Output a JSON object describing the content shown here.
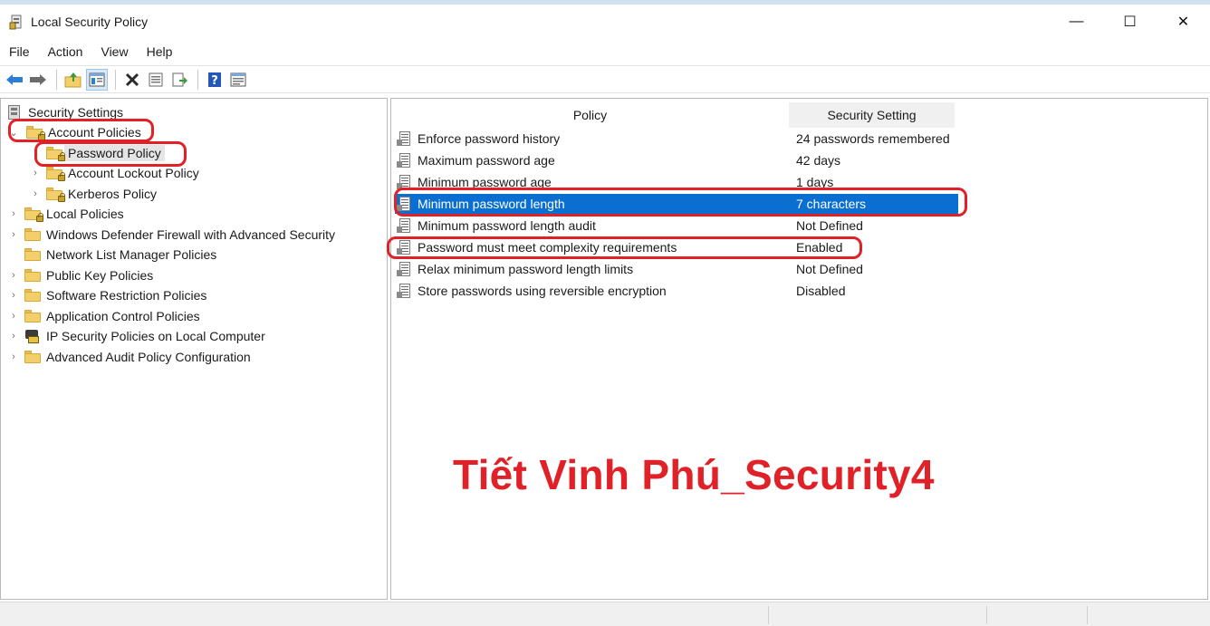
{
  "window": {
    "title": "Local Security Policy",
    "controls": {
      "minimize": "—",
      "maximize": "☐",
      "close": "✕"
    }
  },
  "menu": [
    "File",
    "Action",
    "View",
    "Help"
  ],
  "toolbar": {
    "buttons": [
      "back-icon",
      "forward-icon",
      "up-folder-icon",
      "show-hide-tree-icon",
      "delete-icon",
      "properties-icon",
      "export-list-icon",
      "help-icon",
      "view-icon"
    ]
  },
  "tree": {
    "root": "Security Settings",
    "items": [
      {
        "label": "Account Policies",
        "expanded": true
      },
      {
        "label": "Password Policy",
        "selected": true
      },
      {
        "label": "Account Lockout Policy"
      },
      {
        "label": "Kerberos Policy"
      },
      {
        "label": "Local Policies"
      },
      {
        "label": "Windows Defender Firewall with Advanced Security"
      },
      {
        "label": "Network List Manager Policies"
      },
      {
        "label": "Public Key Policies"
      },
      {
        "label": "Software Restriction Policies"
      },
      {
        "label": "Application Control Policies"
      },
      {
        "label": "IP Security Policies on Local Computer"
      },
      {
        "label": "Advanced Audit Policy Configuration"
      }
    ]
  },
  "list": {
    "columns": {
      "policy": "Policy",
      "setting": "Security Setting"
    },
    "rows": [
      {
        "policy": "Enforce password history",
        "setting": "24 passwords remembered"
      },
      {
        "policy": "Maximum password age",
        "setting": "42 days"
      },
      {
        "policy": "Minimum password age",
        "setting": "1 days"
      },
      {
        "policy": "Minimum password length",
        "setting": "7 characters",
        "selected": true
      },
      {
        "policy": "Minimum password length audit",
        "setting": "Not Defined"
      },
      {
        "policy": "Password must meet complexity requirements",
        "setting": "Enabled"
      },
      {
        "policy": "Relax minimum password length limits",
        "setting": "Not Defined"
      },
      {
        "policy": "Store passwords using reversible encryption",
        "setting": "Disabled"
      }
    ]
  },
  "watermark": "Tiết Vinh Phú_Security4",
  "colors": {
    "selection": "#0a6fd0",
    "annotation": "#e02128",
    "folder": "#f2cf6a"
  }
}
